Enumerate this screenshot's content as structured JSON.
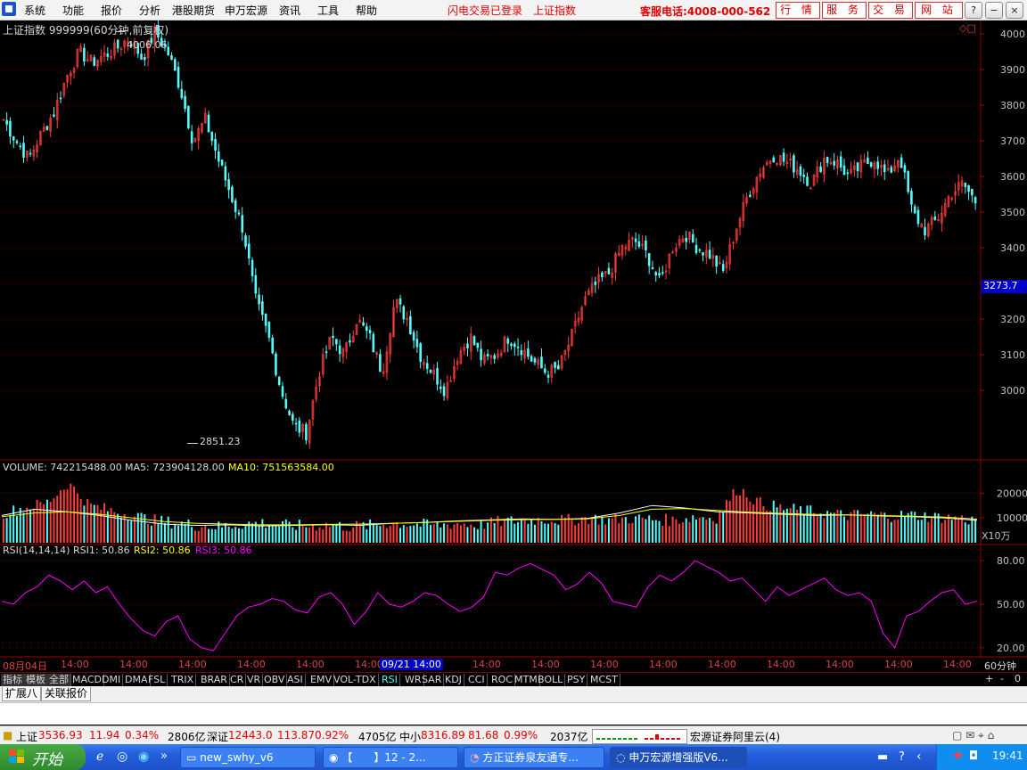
{
  "menubar": {
    "items": [
      "系统",
      "功能",
      "报价",
      "分析",
      "港股期货",
      "申万宏源",
      "资讯",
      "工具",
      "帮助"
    ],
    "status_login": "闪电交易已登录",
    "status_index": "上证指数",
    "hotline": "客服电话:4008-000-562",
    "quick_buttons": [
      "行 情",
      "服 务",
      "交 易",
      "网 站"
    ]
  },
  "chart_header": {
    "title": "上证指数 999999(60分钟,前复权)",
    "high_label": "4006.06",
    "low_label": "2851.23",
    "current_price": "3273.7"
  },
  "volume_header": {
    "volume": "VOLUME: 742215488.00",
    "ma5": "MA5: 723904128.00",
    "ma10": "MA10: 751563584.00",
    "unit": "X10万"
  },
  "rsi_header": {
    "name": "RSI(14,14,14)",
    "rsi1": "RSI1: 50.86",
    "rsi2": "RSI2: 50.86",
    "rsi3": "RSI3: 50.86"
  },
  "time_axis": {
    "labels": [
      "08月04日",
      "14:00",
      "14:00",
      "14:00",
      "14:00",
      "14:00",
      "14:00",
      "14:00",
      "09/21 14:00",
      "14:00",
      "14:00",
      "14:00",
      "14:00",
      "14:00",
      "14:00",
      "14:00",
      "14:00",
      "14:00"
    ],
    "period": "60分钟"
  },
  "indicator_tabs": [
    "指标",
    "模板",
    "全部",
    "MACD",
    "DMI",
    "DMA",
    "FSL",
    "TRIX",
    "BRAR",
    "CR",
    "VR",
    "OBV",
    "ASI",
    "EMV",
    "VOL-TDX",
    "RSI",
    "WR",
    "SAR",
    "KDJ",
    "CCI",
    "ROC",
    "MTM",
    "BOLL",
    "PSY",
    "MCST"
  ],
  "right_controls": [
    "+",
    "-",
    "0"
  ],
  "extension_tabs": [
    "扩展八",
    "关联报价"
  ],
  "status_bar": {
    "sh_name": "上证",
    "sh_value": "3536.93",
    "sh_change": "11.94",
    "sh_pct": "0.34%",
    "sh_amount": "2806亿",
    "sz_name": "深证",
    "sz_value": "12443.0",
    "sz_change": "113.87",
    "sz_pct": "0.92%",
    "sz_amount": "4705亿",
    "zx_name": "中小",
    "zx_value": "8316.89",
    "zx_change": "81.68",
    "zx_pct": "0.99%",
    "zx_amount": "2037亿",
    "server": "宏源证券阿里云(4)"
  },
  "taskbar": {
    "start": "开始",
    "tasks": [
      "new_swhy_v6",
      "【　　】12 - 2...",
      "方正证券泉友通专...",
      "申万宏源增强版V6..."
    ],
    "clock": "19:41"
  },
  "colors": {
    "up": "#ff3c3c",
    "down": "#54fcfc",
    "grid": "#8b0000",
    "ma5": "#ffffff",
    "ma10": "#ffff00",
    "rsi": "#ff00ff"
  },
  "chart_data": [
    {
      "type": "candlestick",
      "title": "上证指数 999999(60分钟,前复权)",
      "y_ticks": [
        3000,
        3100,
        3200,
        3300,
        3400,
        3500,
        3600,
        3700,
        3800,
        3900,
        4000
      ],
      "ylim": [
        2810,
        4015
      ],
      "high": 4006.06,
      "low": 2851.23,
      "last": 3273.7,
      "close_path": [
        3760,
        3700,
        3650,
        3720,
        3780,
        3880,
        3950,
        3920,
        3940,
        3960,
        3990,
        3930,
        4006,
        3950,
        3850,
        3700,
        3760,
        3650,
        3550,
        3450,
        3250,
        3150,
        3000,
        2900,
        2880,
        3050,
        3150,
        3100,
        3200,
        3150,
        3050,
        3250,
        3200,
        3100,
        3050,
        3000,
        3100,
        3150,
        3080,
        3100,
        3150,
        3120,
        3080,
        3050,
        3060,
        3150,
        3250,
        3300,
        3330,
        3400,
        3420,
        3380,
        3300,
        3400,
        3440,
        3400,
        3380,
        3330,
        3450,
        3550,
        3620,
        3660,
        3640,
        3620,
        3580,
        3650,
        3640,
        3600,
        3630,
        3650,
        3600,
        3660,
        3500,
        3450,
        3480,
        3550,
        3580,
        3530
      ]
    },
    {
      "type": "bar",
      "title": "VOLUME",
      "y_ticks": [
        10000,
        20000
      ],
      "ylim": [
        0,
        28000
      ],
      "unit": "X10万",
      "volume_path": [
        12000,
        14000,
        16000,
        24000,
        15000,
        13000,
        11000,
        9000,
        8000,
        7000,
        6500,
        7500,
        8000,
        7000,
        6800,
        7200,
        6500,
        7000,
        8000,
        7500,
        7000,
        7800,
        7200,
        8500,
        9000,
        9500,
        9000,
        10000,
        9200,
        9800,
        9500,
        9000,
        10500,
        10000,
        22000,
        16000,
        14000,
        13000,
        12000,
        11000,
        11500,
        10800,
        11200,
        10500,
        10000,
        9000
      ],
      "ma5_path": [
        11000,
        13500,
        12500,
        11000,
        9000,
        7500,
        7000,
        7200,
        6800,
        7000,
        7300,
        7000,
        7800,
        8200,
        8800,
        9200,
        9600,
        9400,
        9800,
        12000,
        15000,
        14000,
        12500,
        12000,
        11500,
        11000,
        11200,
        10800,
        10500,
        10000,
        9000
      ],
      "ma10_path": [
        10500,
        12000,
        12500,
        11500,
        10000,
        8500,
        7800,
        7500,
        7200,
        7200,
        7400,
        7500,
        7800,
        8200,
        8600,
        9000,
        9300,
        9400,
        9600,
        11000,
        13500,
        13800,
        13000,
        12300,
        11800,
        11400,
        11200,
        11000,
        10700,
        10300,
        9500
      ]
    },
    {
      "type": "line",
      "title": "RSI(14,14,14)",
      "y_ticks": [
        20.0,
        50.0,
        80.0
      ],
      "ylim": [
        15,
        85
      ],
      "series": [
        {
          "name": "RSI1",
          "values": [
            52,
            50,
            58,
            62,
            70,
            66,
            60,
            66,
            58,
            62,
            50,
            40,
            32,
            28,
            38,
            42,
            26,
            20,
            18,
            30,
            42,
            48,
            50,
            54,
            52,
            46,
            44,
            55,
            58,
            50,
            36,
            45,
            58,
            50,
            48,
            52,
            58,
            56,
            50,
            45,
            48,
            55,
            72,
            70,
            75,
            78,
            74,
            70,
            60,
            64,
            72,
            65,
            52,
            50,
            48,
            62,
            70,
            66,
            72,
            80,
            76,
            72,
            66,
            68,
            60,
            52,
            62,
            56,
            60,
            64,
            68,
            60,
            56,
            58,
            52,
            30,
            20,
            42,
            45,
            52,
            58,
            60,
            50,
            52
          ]
        }
      ]
    }
  ]
}
